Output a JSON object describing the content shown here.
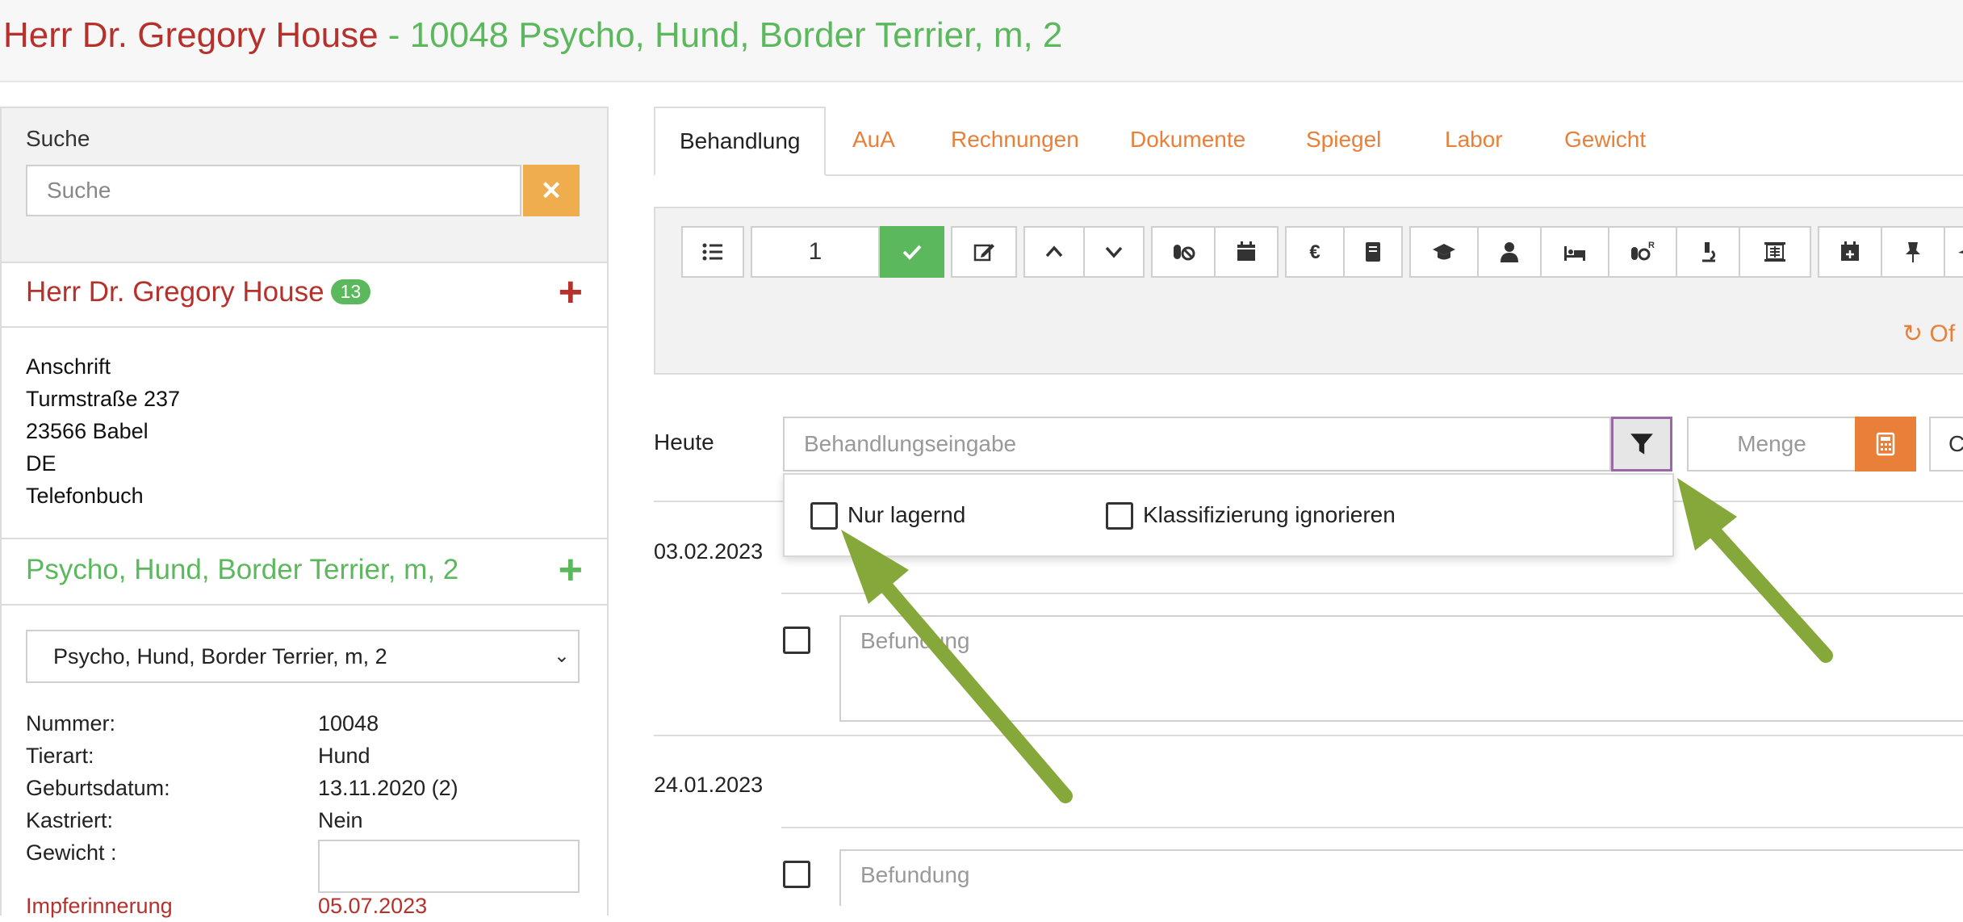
{
  "header": {
    "owner": "Herr Dr. Gregory House",
    "separator": " - ",
    "pet": "10048 Psycho, Hund, Border Terrier, m, 2"
  },
  "search": {
    "label": "Suche",
    "placeholder": "Suche",
    "clear_icon": "times-icon"
  },
  "owner_panel": {
    "name": "Herr Dr. Gregory House",
    "badge": "13",
    "address_lines": [
      "Anschrift",
      "Turmstraße 237",
      "23566  Babel",
      "DE",
      "Telefonbuch"
    ]
  },
  "pet_panel": {
    "name": "Psycho, Hund, Border Terrier, m, 2",
    "select_value": "Psycho, Hund, Border Terrier, m, 2",
    "info": [
      {
        "label": "Nummer:",
        "value": "10048"
      },
      {
        "label": "Tierart:",
        "value": "Hund"
      },
      {
        "label": "Geburtsdatum:",
        "value": "13.11.2020  (2)"
      },
      {
        "label": "Kastriert:",
        "value": "Nein"
      },
      {
        "label": "Gewicht :",
        "value": ""
      }
    ],
    "reminder_label": "Impferinnerung",
    "reminder_value": "05.07.2023"
  },
  "tabs": [
    "Behandlung",
    "AuA",
    "Rechnungen",
    "Dokumente",
    "Spiegel",
    "Labor",
    "Gewicht"
  ],
  "toolbar": {
    "quantity": "1",
    "offline_text": "Of"
  },
  "entry": {
    "heute_label": "Heute",
    "treatment_placeholder": "Behandlungseingabe",
    "menge_placeholder": "Menge",
    "cut_text": "C"
  },
  "filter_dropdown": {
    "option1": "Nur lagernd",
    "option2": "Klassifizierung ignorieren"
  },
  "history": [
    {
      "date": "03.02.2023",
      "befund_placeholder": "Befundung"
    },
    {
      "date": "24.01.2023",
      "befund_placeholder": "Befundung"
    }
  ],
  "colors": {
    "owner_red": "#b7312c",
    "pet_green": "#5cb85c",
    "accent_orange": "#e8803a",
    "search_clear_orange": "#f0ad4e",
    "annotation_arrow": "#86a83a"
  }
}
